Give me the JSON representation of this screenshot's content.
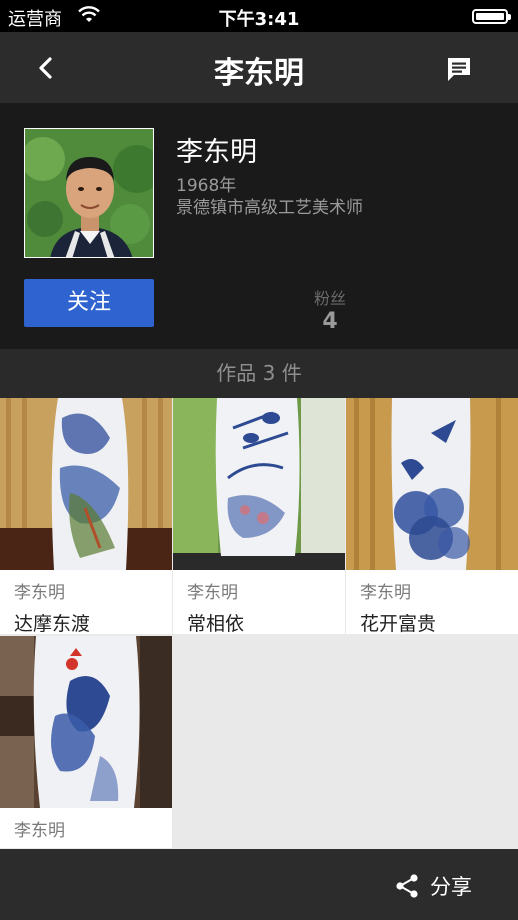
{
  "status_bar": {
    "carrier": "运营商",
    "time": "下午3:41"
  },
  "nav": {
    "title": "李东明"
  },
  "profile": {
    "name": "李东明",
    "year": "1968年",
    "title": "景德镇市高级工艺美术师",
    "follow_label": "关注",
    "fans_label": "粉丝",
    "fans_count": "4"
  },
  "works_header": "作品 3 件",
  "works": [
    {
      "artist": "李东明",
      "name": "达摩东渡"
    },
    {
      "artist": "李东明",
      "name": "常相依"
    },
    {
      "artist": "李东明",
      "name": "花开富贵"
    },
    {
      "artist": "李东明",
      "name": ""
    }
  ],
  "bottom": {
    "share_label": "分享"
  },
  "colors": {
    "follow_button": "#2e63d0",
    "nav_bg": "#2c2c2c",
    "profile_bg": "#1a1a1a"
  }
}
